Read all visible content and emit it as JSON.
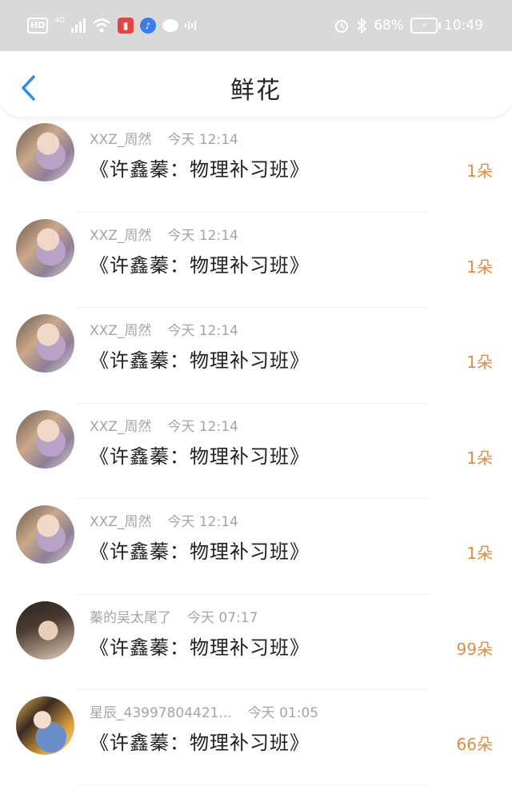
{
  "status_bar": {
    "hd": "HD",
    "network": "4G",
    "battery_pct": "68%",
    "time": "10:49"
  },
  "header": {
    "title": "鲜花"
  },
  "colors": {
    "accent_back": "#2f8fe6",
    "count_orange": "#e28c3d",
    "meta_gray": "#a4a4a4"
  },
  "rows": [
    {
      "name": "XXZ_周然",
      "time": "今天 12:14",
      "book": "《许鑫蓁：物理补习班》",
      "count": "1朵"
    },
    {
      "name": "XXZ_周然",
      "time": "今天 12:14",
      "book": "《许鑫蓁：物理补习班》",
      "count": "1朵"
    },
    {
      "name": "XXZ_周然",
      "time": "今天 12:14",
      "book": "《许鑫蓁：物理补习班》",
      "count": "1朵"
    },
    {
      "name": "XXZ_周然",
      "time": "今天 12:14",
      "book": "《许鑫蓁：物理补习班》",
      "count": "1朵"
    },
    {
      "name": "XXZ_周然",
      "time": "今天 12:14",
      "book": "《许鑫蓁：物理补习班》",
      "count": "1朵"
    },
    {
      "name": "蓁的吴太尾了",
      "time": "今天 07:17",
      "book": "《许鑫蓁：物理补习班》",
      "count": "99朵"
    },
    {
      "name": "星辰_43997804421...",
      "time": "今天 01:05",
      "book": "《许鑫蓁：物理补习班》",
      "count": "66朵"
    }
  ]
}
